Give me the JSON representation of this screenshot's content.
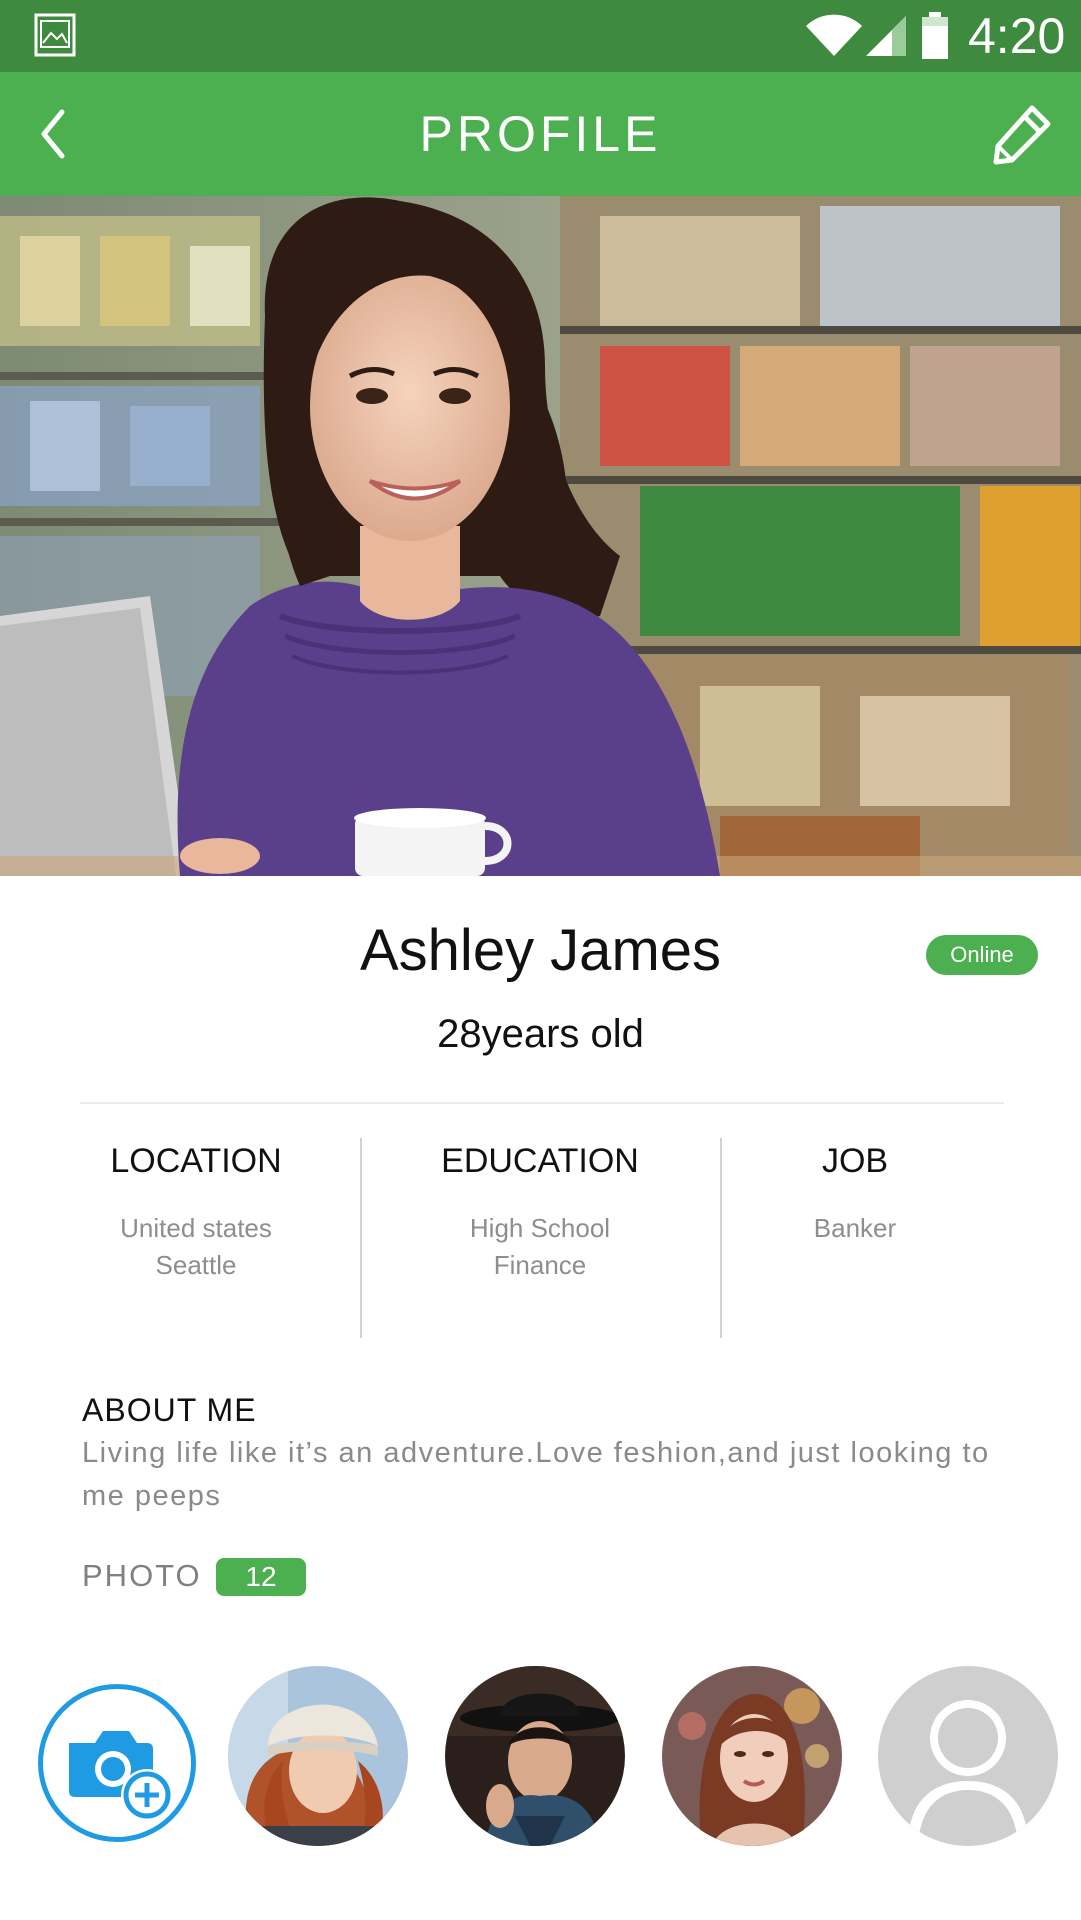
{
  "status_bar": {
    "time": "4:20",
    "icons": [
      "gallery-icon",
      "wifi-icon",
      "signal-icon",
      "battery-icon"
    ]
  },
  "app_bar": {
    "title": "PROFILE",
    "back_icon": "chevron-left-icon",
    "edit_icon": "pencil-icon",
    "color": "#4caf50"
  },
  "profile": {
    "name": "Ashley James",
    "age": "28years old",
    "status": "Online"
  },
  "info": [
    {
      "heading": "LOCATION",
      "lines": [
        "United states",
        "Seattle"
      ]
    },
    {
      "heading": "EDUCATION",
      "lines": [
        "High School",
        "Finance"
      ]
    },
    {
      "heading": "JOB",
      "lines": [
        "Banker"
      ]
    }
  ],
  "about": {
    "heading": "ABOUT ME",
    "text": "Living life like it’s an adventure.Love feshion,and just looking to me peeps"
  },
  "photos": {
    "label": "PHOTO",
    "count": "12",
    "add_icon": "camera-add-icon",
    "placeholder_icon": "user-placeholder-icon"
  },
  "colors": {
    "accent": "#4caf50",
    "status_bar": "#3e8a3e",
    "add_photo_ring": "#1e9be3"
  }
}
